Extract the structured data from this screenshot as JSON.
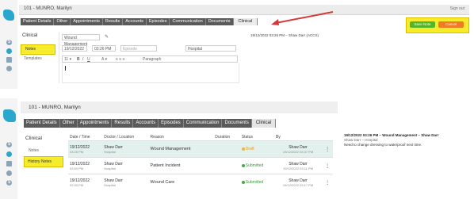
{
  "screen1": {
    "patient_title": "101 - MUNRO, Marilyn",
    "top_right_link": "Sign out",
    "tabs": [
      "Patient Details",
      "Other",
      "Appointments",
      "Results",
      "Accounts",
      "Episodes",
      "Communication",
      "Documents",
      "Clinical"
    ],
    "active_tab": "Clinical",
    "buttons": {
      "save": "Save Note",
      "cancel": "Cancel"
    },
    "sidebar": {
      "heading": "Clinical",
      "highlighted_item": "Notes",
      "item2": "Templates"
    },
    "form": {
      "title_value": "Wound Management",
      "date_value": "19/12/2022",
      "time_value": "03:26 PM",
      "episode_placeholder": "Episode",
      "practitioner_value": "Hospital",
      "format_value": "Paragraph"
    },
    "right_heading": "19/12/2022 03:26 PM – Shaw Darr (ACCS)",
    "colors": {
      "highlight": "#f6ec2a",
      "save_green": "#54b52b",
      "cancel_orange": "#ef7c22",
      "arrow_red": "#d43a3a",
      "tab_dark": "#5a5a5a",
      "brand": "#2aa7cc"
    }
  },
  "screen2": {
    "patient_title": "101 - MUNRO, Marilyn",
    "tabs": [
      "Patient Details",
      "Other",
      "Appointments",
      "Results",
      "Accounts",
      "Episodes",
      "Communication",
      "Documents",
      "Clinical"
    ],
    "active_tab": "Clinical",
    "sidebar": {
      "heading": "Clinical",
      "item1": "Notes",
      "highlighted_item": "History Notes"
    },
    "table": {
      "headers": [
        "Date / Time",
        "Doctor / Location",
        "Reason",
        "Duration",
        "Status",
        "By"
      ],
      "rows": [
        {
          "date": "19/12/2022",
          "time": "03:26 PM",
          "doctor": "Shaw Darr",
          "location": "Hospital",
          "reason": "Wound Management",
          "duration": "",
          "status": "Draft",
          "by": "Shaw Darr",
          "by_time": "19/12/2022 03:37 PM"
        },
        {
          "date": "19/12/2022",
          "time": "02:50 PM",
          "doctor": "Shaw Darr",
          "location": "Hospital",
          "reason": "Patient Incident",
          "duration": "",
          "status": "Submitted",
          "by": "Shaw Darr",
          "by_time": "19/12/2022 03:11 PM"
        },
        {
          "date": "19/12/2022",
          "time": "02:30 PM",
          "doctor": "Shaw Darr",
          "location": "Hospital",
          "reason": "Wound Care",
          "duration": "",
          "status": "Submitted",
          "by": "Shaw Darr",
          "by_time": "19/12/2022 03:17 PM"
        }
      ]
    },
    "preview": {
      "heading": "19/12/2022 03:26 PM – Wound Management – Shaw Darr",
      "subheading": "Shaw Darr – Hospital",
      "body": "Need to change dressing to waterproof next time."
    },
    "colors": {
      "draft": "#f3b23a",
      "submitted": "#4aa84a"
    }
  }
}
